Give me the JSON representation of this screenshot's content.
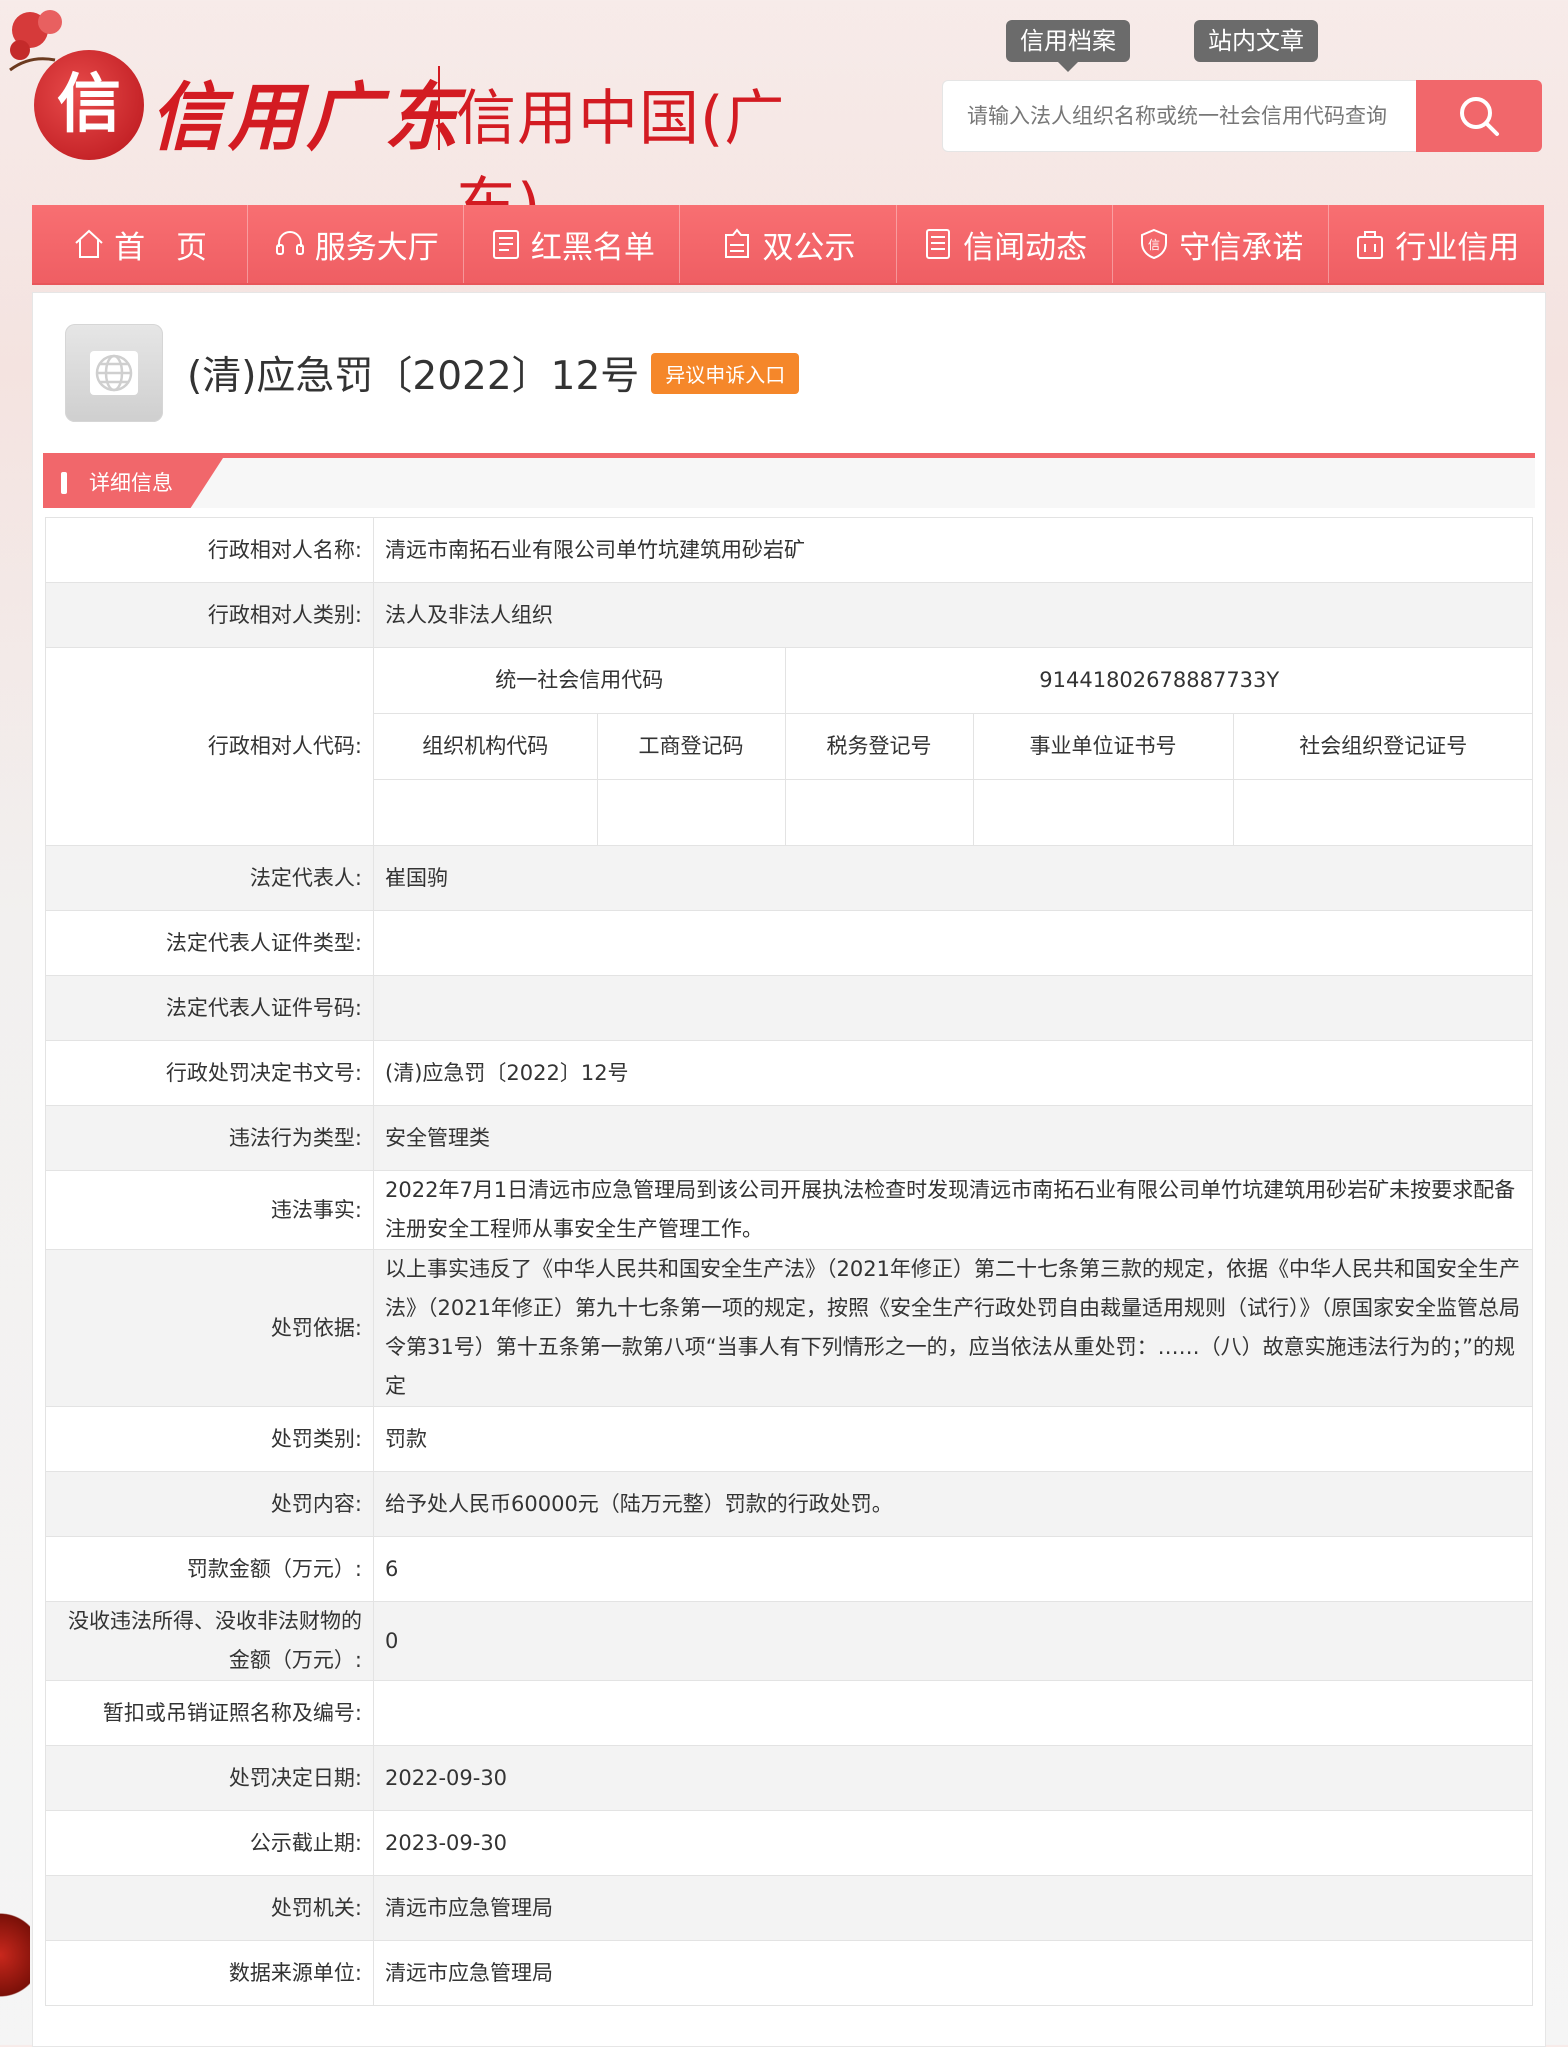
{
  "header": {
    "logo_badge_glyph": "信",
    "logo_script": "信用广东",
    "site_name": "信用中国(广东)"
  },
  "quick_tabs": [
    "信用档案",
    "站内文章"
  ],
  "search": {
    "placeholder": "请输入法人组织名称或统一社会信用代码查询"
  },
  "nav": [
    {
      "label": "首　页",
      "icon": "home-icon"
    },
    {
      "label": "服务大厅",
      "icon": "headset-icon"
    },
    {
      "label": "红黑名单",
      "icon": "list-icon"
    },
    {
      "label": "双公示",
      "icon": "badge-icon"
    },
    {
      "label": "信闻动态",
      "icon": "document-icon"
    },
    {
      "label": "守信承诺",
      "icon": "shield-icon"
    },
    {
      "label": "行业信用",
      "icon": "building-icon"
    }
  ],
  "page": {
    "title": "(清)应急罚〔2022〕12号",
    "appeal_label": "异议申诉入口",
    "section_label": "详细信息"
  },
  "colors": {
    "brand_red": "#f1676b",
    "logo_red": "#d31b22",
    "appeal_orange": "#f5872a",
    "tab_gray": "#6b6b6b"
  },
  "detail": {
    "subject_name_label": "行政相对人名称:",
    "subject_name": "清远市南拓石业有限公司单竹坑建筑用砂岩矿",
    "subject_type_label": "行政相对人类别:",
    "subject_type": "法人及非法人组织",
    "subject_code_label": "行政相对人代码:",
    "codes": {
      "uscc_label": "统一社会信用代码",
      "uscc_value": "91441802678887733Y",
      "org_code_label": "组织机构代码",
      "business_reg_label": "工商登记码",
      "tax_reg_label": "税务登记号",
      "institution_cert_label": "事业单位证书号",
      "social_org_label": "社会组织登记证号"
    },
    "legal_rep_label": "法定代表人:",
    "legal_rep": "崔国驹",
    "legal_rep_id_type_label": "法定代表人证件类型:",
    "legal_rep_id_type": "",
    "legal_rep_id_no_label": "法定代表人证件号码:",
    "legal_rep_id_no": "",
    "decision_no_label": "行政处罚决定书文号:",
    "decision_no": "(清)应急罚〔2022〕12号",
    "violation_type_label": "违法行为类型:",
    "violation_type": "安全管理类",
    "violation_facts_label": "违法事实:",
    "violation_facts": "2022年7月1日清远市应急管理局到该公司开展执法检查时发现清远市南拓石业有限公司单竹坑建筑用砂岩矿未按要求配备注册安全工程师从事安全生产管理工作。",
    "penalty_basis_label": "处罚依据:",
    "penalty_basis": "以上事实违反了《中华人民共和国安全生产法》（2021年修正）第二十七条第三款的规定，依据《中华人民共和国安全生产法》（2021年修正）第九十七条第一项的规定，按照《安全生产行政处罚自由裁量适用规则（试行）》（原国家安全监管总局令第31号）第十五条第一款第八项“当事人有下列情形之一的，应当依法从重处罚：……（八）故意实施违法行为的；”的规定",
    "penalty_category_label": "处罚类别:",
    "penalty_category": "罚款",
    "penalty_content_label": "处罚内容:",
    "penalty_content": "给予处人民币60000元（陆万元整）罚款的行政处罚。",
    "fine_amount_label": "罚款金额（万元）:",
    "fine_amount": "6",
    "confiscation_label": "没收违法所得、没收非法财物的金额（万元）:",
    "confiscation_amount": "0",
    "license_revoke_label": "暂扣或吊销证照名称及编号:",
    "license_revoke": "",
    "decision_date_label": "处罚决定日期:",
    "decision_date": "2022-09-30",
    "publicity_deadline_label": "公示截止期:",
    "publicity_deadline": "2023-09-30",
    "authority_label": "处罚机关:",
    "authority": "清远市应急管理局",
    "data_source_label": "数据来源单位:",
    "data_source": "清远市应急管理局"
  }
}
